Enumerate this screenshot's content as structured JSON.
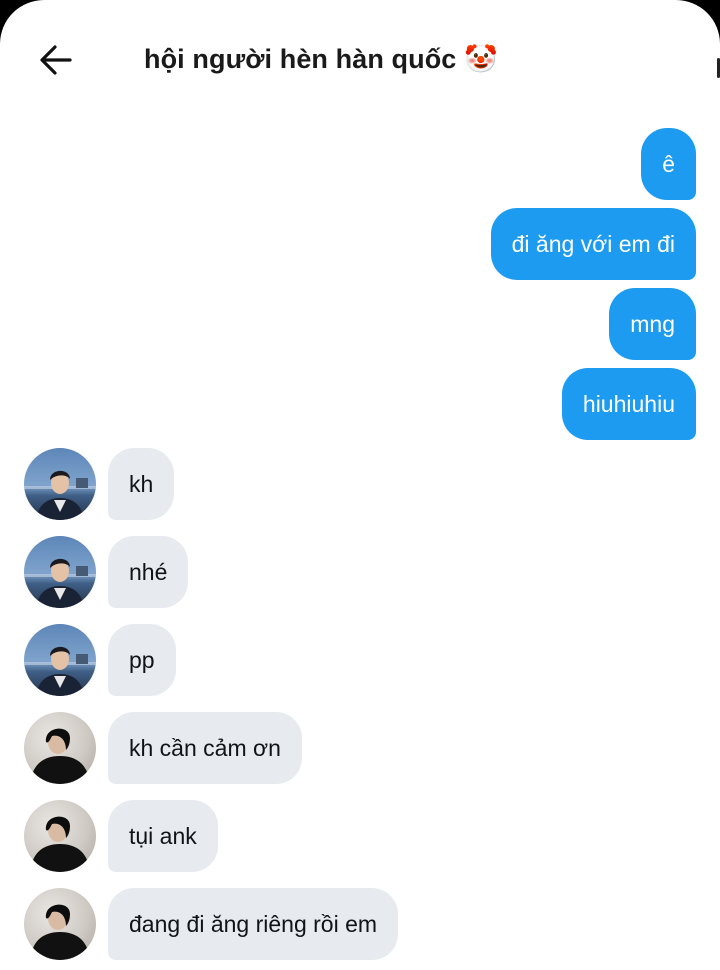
{
  "header": {
    "title": "hội người hèn hàn quốc 🤡",
    "back_icon": "arrow-left-icon"
  },
  "colors": {
    "outgoing_bubble": "#1d9bf0",
    "incoming_bubble": "#e7ebef"
  },
  "messages": [
    {
      "direction": "outgoing",
      "text": "ê"
    },
    {
      "direction": "outgoing",
      "text": "đi ăng với em đi"
    },
    {
      "direction": "outgoing",
      "text": "mng"
    },
    {
      "direction": "outgoing",
      "text": "hiuhiuhiu"
    },
    {
      "direction": "incoming",
      "avatar": "user-a",
      "text": "kh"
    },
    {
      "direction": "incoming",
      "avatar": "user-a",
      "text": "nhé"
    },
    {
      "direction": "incoming",
      "avatar": "user-a",
      "text": "pp"
    },
    {
      "direction": "incoming",
      "avatar": "user-b",
      "text": "kh cần cảm ơn"
    },
    {
      "direction": "incoming",
      "avatar": "user-b",
      "text": "tụi ank"
    },
    {
      "direction": "incoming",
      "avatar": "user-b",
      "text": "đang đi ăng riêng rồi em"
    }
  ]
}
